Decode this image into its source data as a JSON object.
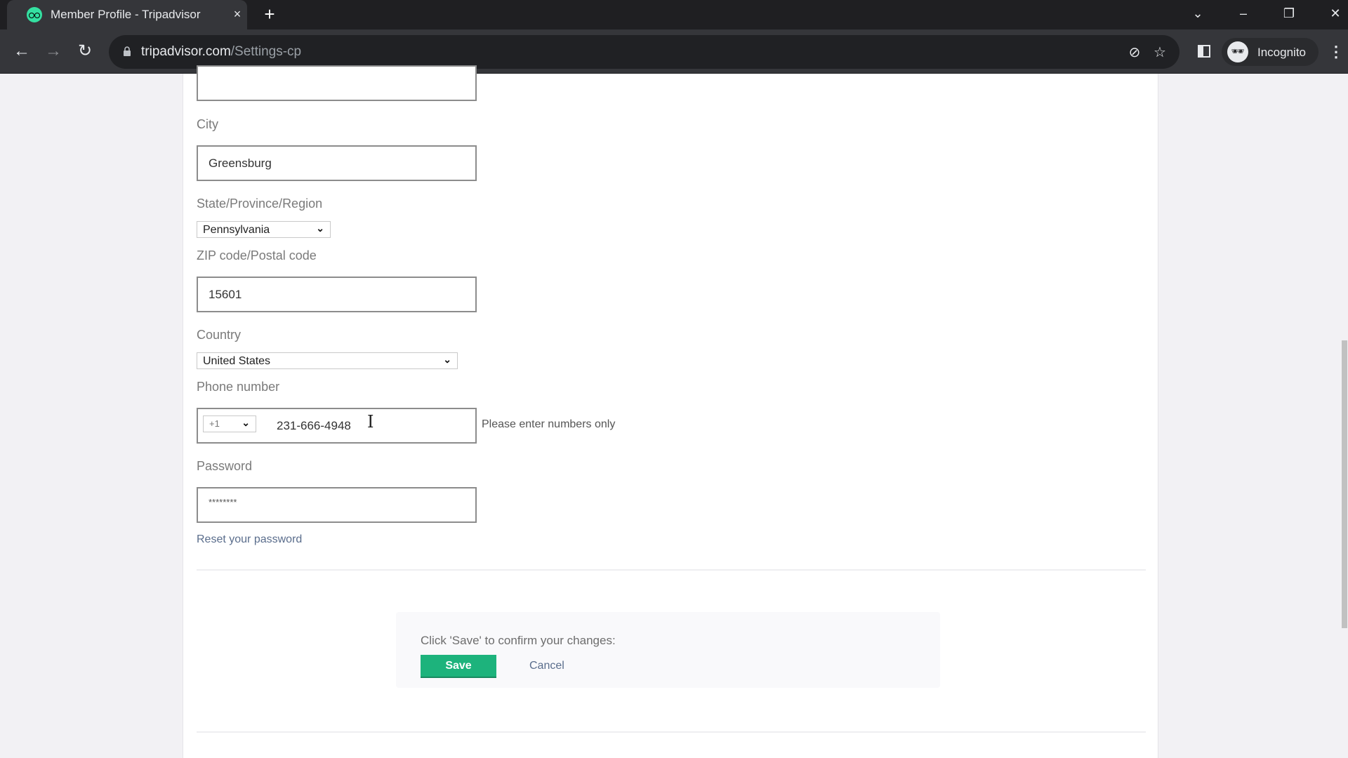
{
  "browser": {
    "tab_title": "Member Profile - Tripadvisor",
    "url_domain": "tripadvisor.com",
    "url_path": "/Settings-cp",
    "profile_label": "Incognito",
    "icons": {
      "favicon": "tripadvisor-owl-icon",
      "close": "×",
      "new_tab": "+",
      "back": "←",
      "forward": "→",
      "reload": "↻",
      "tab_search": "⌄",
      "minimize": "–",
      "restore": "❐",
      "window_close": "✕",
      "eye_off": "⊘",
      "star": "☆",
      "incognito": "🕶",
      "menu": "⋮"
    }
  },
  "form": {
    "city": {
      "label": "City",
      "value": "Greensburg"
    },
    "state": {
      "label": "State/Province/Region",
      "value": "Pennsylvania"
    },
    "zip": {
      "label": "ZIP code/Postal code",
      "value": "15601"
    },
    "country": {
      "label": "Country",
      "value": "United States"
    },
    "phone": {
      "label": "Phone number",
      "country_code": "+1",
      "value": "231-666-4948",
      "hint": "Please enter numbers only"
    },
    "password": {
      "label": "Password",
      "value": "********",
      "reset_link": "Reset your password"
    }
  },
  "confirm": {
    "message": "Click 'Save' to confirm your changes:",
    "save_label": "Save",
    "cancel_label": "Cancel"
  },
  "colors": {
    "save_green": "#1db37c",
    "link_blue": "#5a6d8c"
  }
}
